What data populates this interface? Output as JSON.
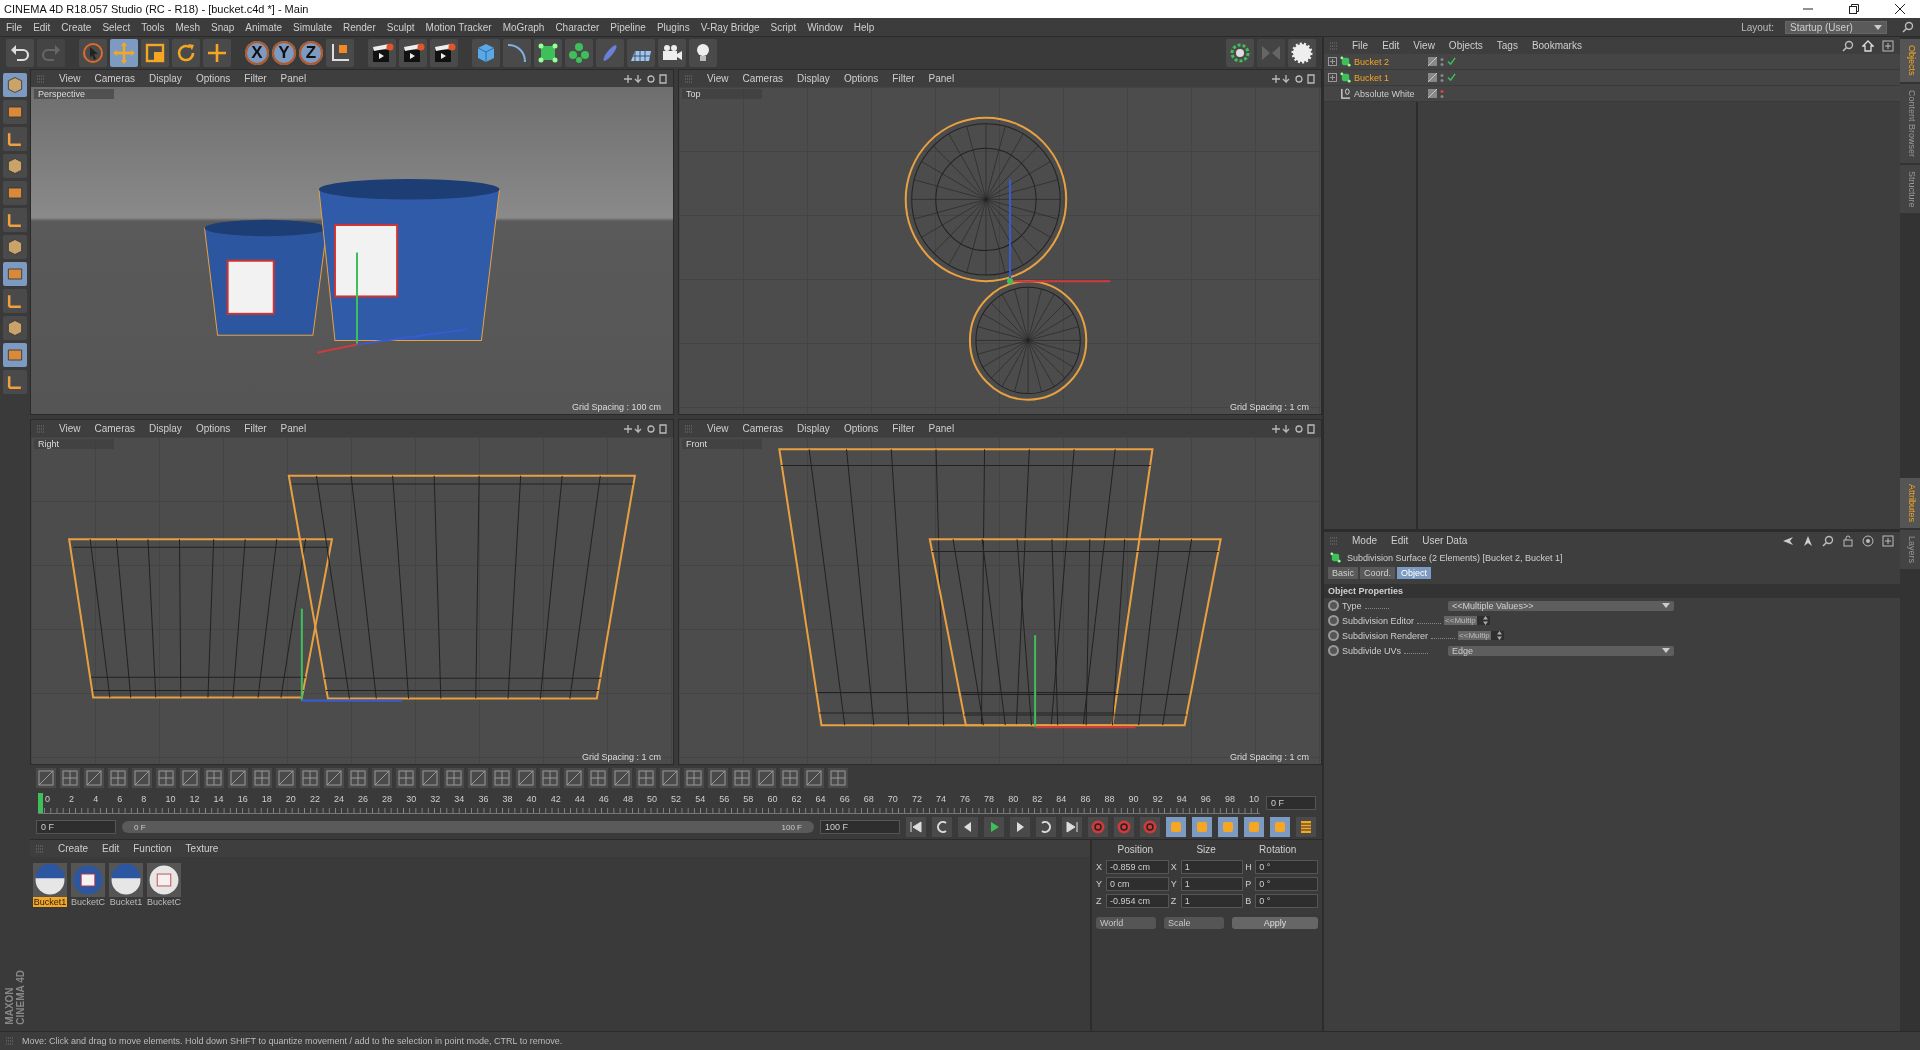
{
  "window": {
    "title": "CINEMA 4D R18.057 Studio (RC - R18) - [bucket.c4d *] - Main"
  },
  "menu": [
    "File",
    "Edit",
    "Create",
    "Select",
    "Tools",
    "Mesh",
    "Snap",
    "Animate",
    "Simulate",
    "Render",
    "Sculpt",
    "Motion Tracker",
    "MoGraph",
    "Character",
    "Pipeline",
    "Plugins",
    "V-Ray Bridge",
    "Script",
    "Window",
    "Help"
  ],
  "layout": {
    "label": "Layout:",
    "value": "Startup (User)"
  },
  "toolbar": {
    "axes": [
      {
        "label": "X",
        "on": true
      },
      {
        "label": "Y",
        "on": true
      },
      {
        "label": "Z",
        "on": true
      }
    ]
  },
  "viewports": [
    {
      "name": "Perspective",
      "kind": "perspective",
      "menu": [
        "View",
        "Cameras",
        "Display",
        "Options",
        "Filter",
        "Panel"
      ],
      "grid_spacing": "Grid Spacing : 100 cm"
    },
    {
      "name": "Top",
      "kind": "top",
      "menu": [
        "View",
        "Cameras",
        "Display",
        "Options",
        "Filter",
        "Panel"
      ],
      "grid_spacing": "Grid Spacing : 1 cm"
    },
    {
      "name": "Right",
      "kind": "right",
      "menu": [
        "View",
        "Cameras",
        "Display",
        "Options",
        "Filter",
        "Panel"
      ],
      "grid_spacing": "Grid Spacing : 1 cm"
    },
    {
      "name": "Front",
      "kind": "front",
      "menu": [
        "View",
        "Cameras",
        "Display",
        "Options",
        "Filter",
        "Panel"
      ],
      "grid_spacing": "Grid Spacing : 1 cm"
    }
  ],
  "timeline": {
    "ticks": [
      "0",
      "2",
      "4",
      "6",
      "8",
      "10",
      "12",
      "14",
      "16",
      "18",
      "20",
      "22",
      "24",
      "26",
      "28",
      "30",
      "32",
      "34",
      "36",
      "38",
      "40",
      "42",
      "44",
      "46",
      "48",
      "50",
      "52",
      "54",
      "56",
      "58",
      "60",
      "62",
      "64",
      "66",
      "68",
      "70",
      "72",
      "74",
      "76",
      "78",
      "80",
      "82",
      "84",
      "86",
      "88",
      "90",
      "92",
      "94",
      "96",
      "98",
      "10"
    ],
    "level": 0,
    "current": "0 F",
    "start": "0 F",
    "range": {
      "start": "0 F",
      "end": "100 F",
      "level": 1
    },
    "end": "100 F"
  },
  "materials": {
    "menu": [
      "Create",
      "Edit",
      "Function",
      "Texture"
    ],
    "items": [
      {
        "name": "Bucket1",
        "kind": "white",
        "selected": true
      },
      {
        "name": "BucketC",
        "kind": "blue",
        "selected": false
      },
      {
        "name": "Bucket1",
        "kind": "white",
        "selected": false
      },
      {
        "name": "BucketC",
        "kind": "label",
        "selected": false
      }
    ]
  },
  "coordinates": {
    "headers": [
      "Position",
      "Size",
      "Rotation"
    ],
    "rows": [
      {
        "axis": "X",
        "position": "-0.859 cm",
        "size_axis": "X",
        "size": "1",
        "rotation_axis": "H",
        "rotation": "0 °"
      },
      {
        "axis": "Y",
        "position": "0 cm",
        "size_axis": "Y",
        "size": "1",
        "rotation_axis": "P",
        "rotation": "0 °"
      },
      {
        "axis": "Z",
        "position": "-0.954 cm",
        "size_axis": "Z",
        "size": "1",
        "rotation_axis": "B",
        "rotation": "0 °"
      }
    ],
    "mode": "World",
    "size_mode": "Scale",
    "apply": "Apply"
  },
  "objects": {
    "menu": [
      "File",
      "Edit",
      "View",
      "Objects",
      "Tags",
      "Bookmarks"
    ],
    "items": [
      {
        "name": "Bucket 2",
        "kind": "subdivision",
        "selected": true,
        "collapsible": true,
        "checked": true
      },
      {
        "name": "Bucket 1",
        "kind": "subdivision",
        "selected": true,
        "collapsible": true,
        "checked": true
      },
      {
        "name": "Absolute White",
        "kind": "null",
        "selected": false,
        "collapsible": false,
        "checked": false
      }
    ]
  },
  "attributes": {
    "menu": [
      "Mode",
      "Edit",
      "User Data"
    ],
    "title": "Subdivision Surface (2 Elements) [Bucket 2, Bucket 1]",
    "tabs": [
      {
        "label": "Basic",
        "selected": false
      },
      {
        "label": "Coord.",
        "selected": false
      },
      {
        "label": "Object",
        "selected": true
      }
    ],
    "section": "Object Properties",
    "fields": [
      {
        "label": "Type",
        "kind": "dropdown",
        "value": "<<Multiple Values>>"
      },
      {
        "label": "Subdivision Editor",
        "kind": "spinner",
        "value": "<<Multip"
      },
      {
        "label": "Subdivision Renderer",
        "kind": "spinner",
        "value": "<<Multip"
      },
      {
        "label": "Subdivide UVs",
        "kind": "dropdown",
        "value": "Edge"
      }
    ]
  },
  "side_tabs": [
    {
      "label": "Objects",
      "selected": true
    },
    {
      "label": "Content Browser",
      "selected": false
    },
    {
      "label": "Structure",
      "selected": false
    }
  ],
  "attribute_side_tabs": [
    {
      "label": "Attributes",
      "selected": true
    },
    {
      "label": "Layers",
      "selected": false
    }
  ],
  "logo": [
    "MAXON",
    "CINEMA 4D"
  ],
  "status": "Move: Click and drag to move elements. Hold down SHIFT to quantize movement / add to the selection in point mode, CTRL to remove."
}
